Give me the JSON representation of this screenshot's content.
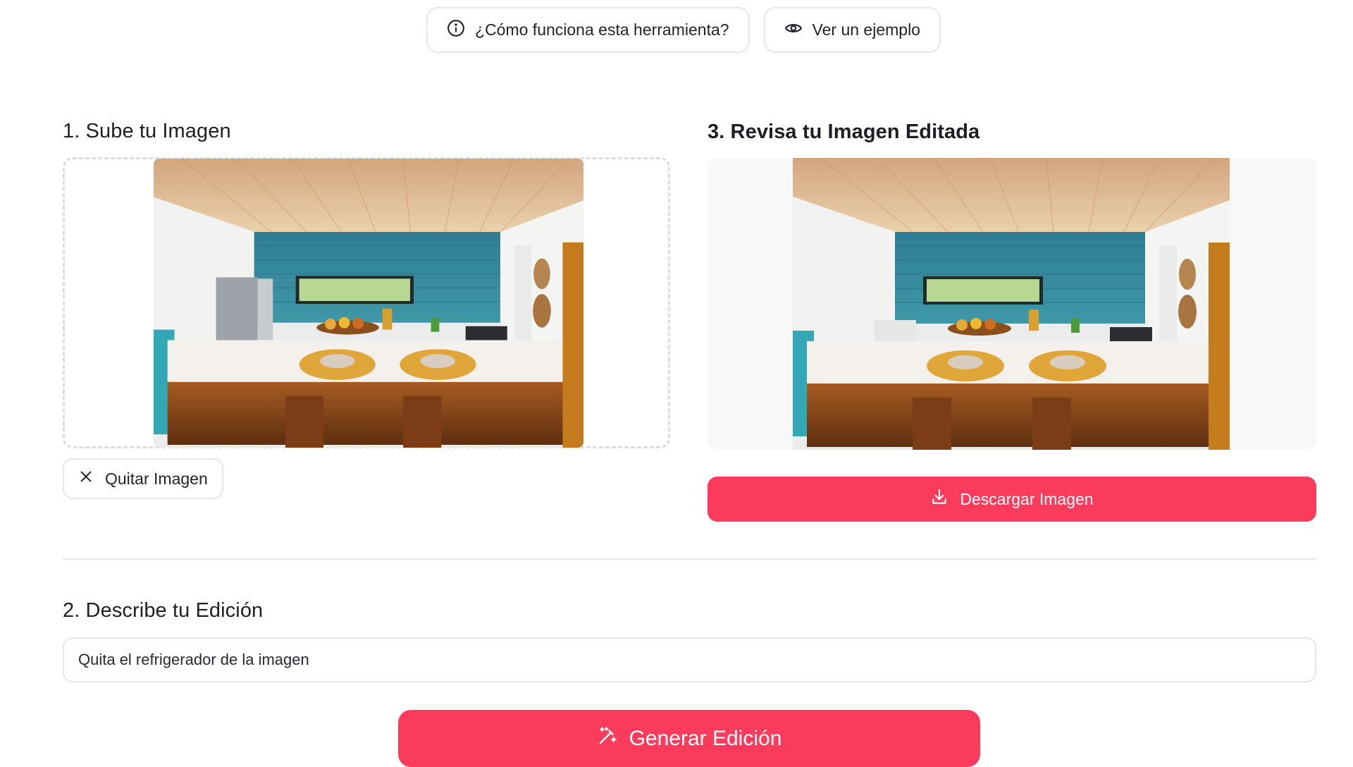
{
  "help": {
    "how_label": "¿Cómo funciona esta herramienta?",
    "how_icon": "info-icon",
    "example_label": "Ver un ejemplo",
    "example_icon": "eye-icon"
  },
  "upload": {
    "title": "1. Sube tu Imagen",
    "image_description": "Kitchen with wooden ceiling, blue tile wall, stainless refrigerator, white island countertop with wooden chairs",
    "remove_label": "Quitar Imagen",
    "remove_icon": "close-icon"
  },
  "result": {
    "title": "3. Revisa tu Imagen Editada",
    "image_description": "Same kitchen with the refrigerator removed",
    "download_label": "Descargar Imagen",
    "download_icon": "download-icon"
  },
  "edit": {
    "title": "2. Describe tu Edición",
    "prompt_value": "Quita el refrigerador de la imagen",
    "generate_label": "Generar Edición",
    "generate_icon": "magic-wand-icon"
  },
  "colors": {
    "accent": "#fb3b5c",
    "border": "#e6e7eb",
    "text": "#1f2430"
  }
}
